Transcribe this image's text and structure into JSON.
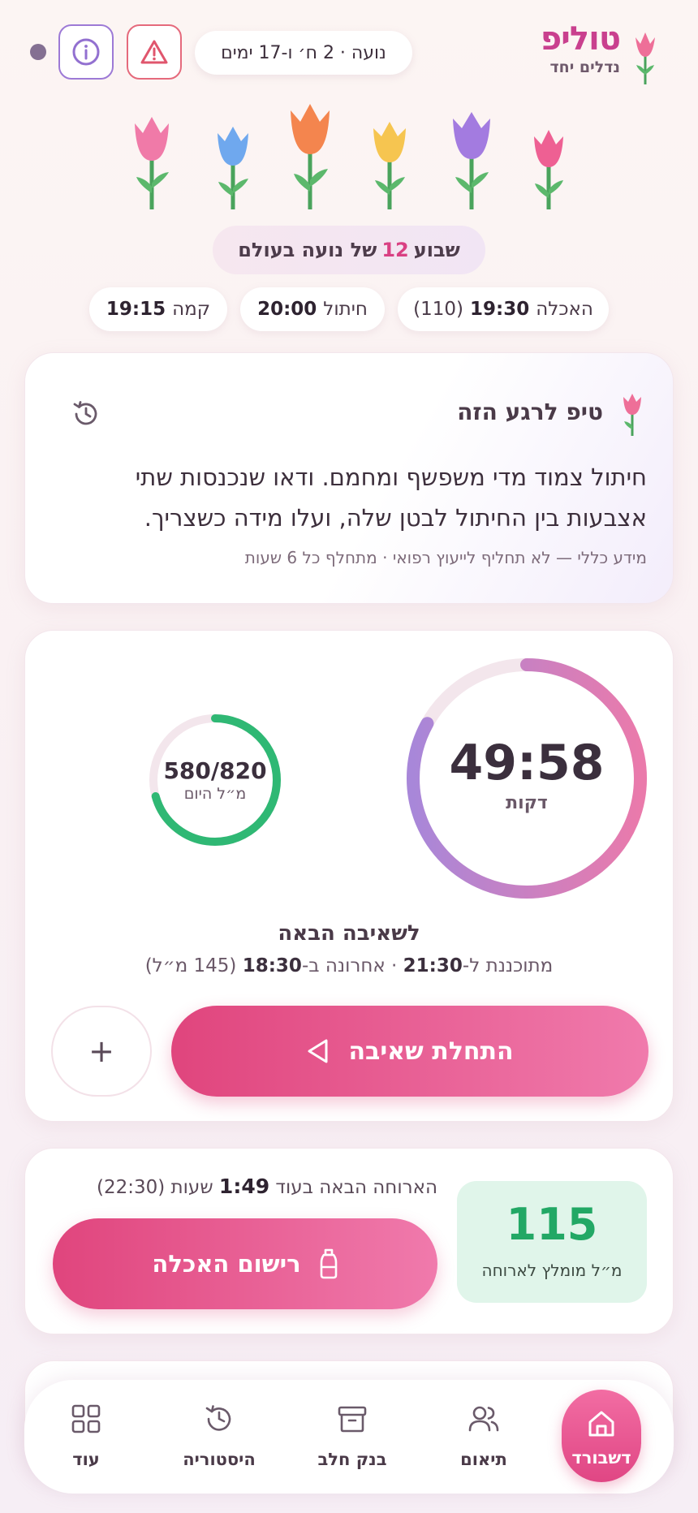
{
  "header": {
    "app_name": "טוליפ",
    "tagline": "נדלים יחד",
    "baby_info": "נועה · 2 ח׳ ו-17 ימים",
    "alert_icon": "warning-triangle-icon",
    "info_icon": "info-icon"
  },
  "week": {
    "prefix": "שבוע",
    "number": "12",
    "suffix": "של נועה בעולם"
  },
  "schedule": [
    {
      "label": "האכלה",
      "time": "19:30",
      "extra": "(110)"
    },
    {
      "label": "חיתול",
      "time": "20:00",
      "extra": ""
    },
    {
      "label": "קמה",
      "time": "19:15",
      "extra": ""
    }
  ],
  "tip": {
    "title": "טיפ לרגע הזה",
    "body": "חיתול צמוד מדי משפשף ומחמם. ודאו שנכנסות שתי אצבעות בין החיתול לבטן שלה, ועלו מידה כשצריך.",
    "note": "מידע כללי — לא תחליף לייעוץ רפואי · מתחלף כל 6 שעות"
  },
  "timer": {
    "value": "49:58",
    "unit": "דקות",
    "progress_fraction": 0.83
  },
  "daily_volume": {
    "value": "580/820",
    "unit": "מ״ל היום",
    "consumed": 580,
    "goal": 820
  },
  "next_pump": {
    "title": "לשאיבה הבאה",
    "planned_prefix": "מתוכננת ל-",
    "planned_time": "21:30",
    "last_prefix": " · אחרונה ב-",
    "last_time": "18:30",
    "last_amount": " (145 מ״ל)"
  },
  "actions": {
    "start_pump": "התחלת שאיבה",
    "add": "+",
    "log_feed": "רישום האכלה"
  },
  "feeding": {
    "recommended_value": "115",
    "recommended_label": "מ״ל מומלץ לארוחה",
    "next_meal_prefix": "הארוחה הבאה בעוד ",
    "next_meal_time": "1:49",
    "next_meal_suffix": " שעות (22:30)"
  },
  "nav": [
    {
      "label": "דשבורד",
      "icon": "home-icon",
      "active": true
    },
    {
      "label": "תיאום",
      "icon": "users-icon",
      "active": false
    },
    {
      "label": "בנק חלב",
      "icon": "archive-box-icon",
      "active": false
    },
    {
      "label": "היסטוריה",
      "icon": "history-icon",
      "active": false
    },
    {
      "label": "עוד",
      "icon": "grid-icon",
      "active": false
    }
  ],
  "colors": {
    "brand": "#c9408e",
    "primary_button": "#e0457d",
    "daily_ring": "#2fb874",
    "timer_ring_start": "#a887d9",
    "timer_ring_end": "#ea7aab",
    "recommend_bg": "#e0f5ea"
  }
}
